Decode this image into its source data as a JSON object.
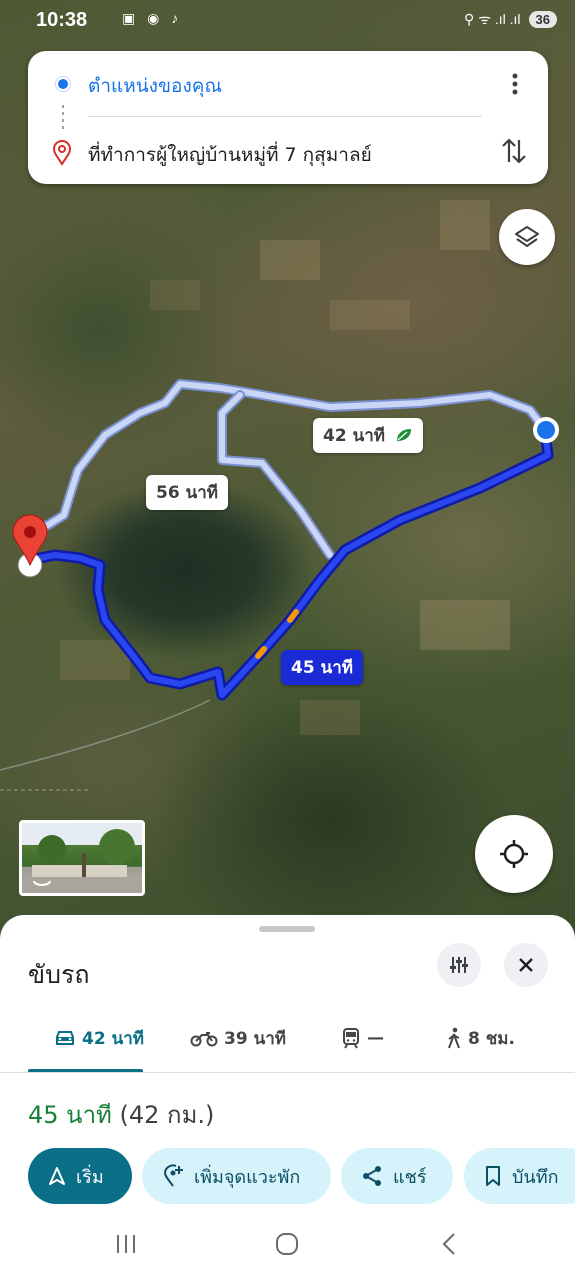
{
  "status_bar": {
    "time": "10:38",
    "apps": "▣ ◉ ♪",
    "signal": "⚲ ᯤ .ıl .ıl",
    "battery": "36"
  },
  "directions": {
    "origin": "ตำแหน่งของคุณ",
    "destination": "ที่ทำการผู้ใหญ่บ้านหมู่ที่ 7 กุสุมาลย์"
  },
  "map": {
    "route_labels": {
      "alt_fast": "42 นาที",
      "alt_slow": "56 นาที",
      "main": "45 นาที"
    },
    "colors": {
      "main_route": "#1a2bd6",
      "alt_route": "#b4c6f0",
      "leaf": "#1e8e3e"
    }
  },
  "sheet": {
    "title": "ขับรถ",
    "tabs": [
      {
        "icon": "car-icon",
        "label": "42 นาที"
      },
      {
        "icon": "motorcycle-icon",
        "label": "39 นาที"
      },
      {
        "icon": "train-icon",
        "label": "—"
      },
      {
        "icon": "walk-icon",
        "label": "8 ชม."
      }
    ],
    "summary_duration": "45 นาที",
    "summary_distance": "(42 กม.)",
    "buttons": {
      "start": "เริ่ม",
      "add_stop": "เพิ่มจุดแวะพัก",
      "share": "แชร์",
      "save": "บันทึก"
    }
  }
}
